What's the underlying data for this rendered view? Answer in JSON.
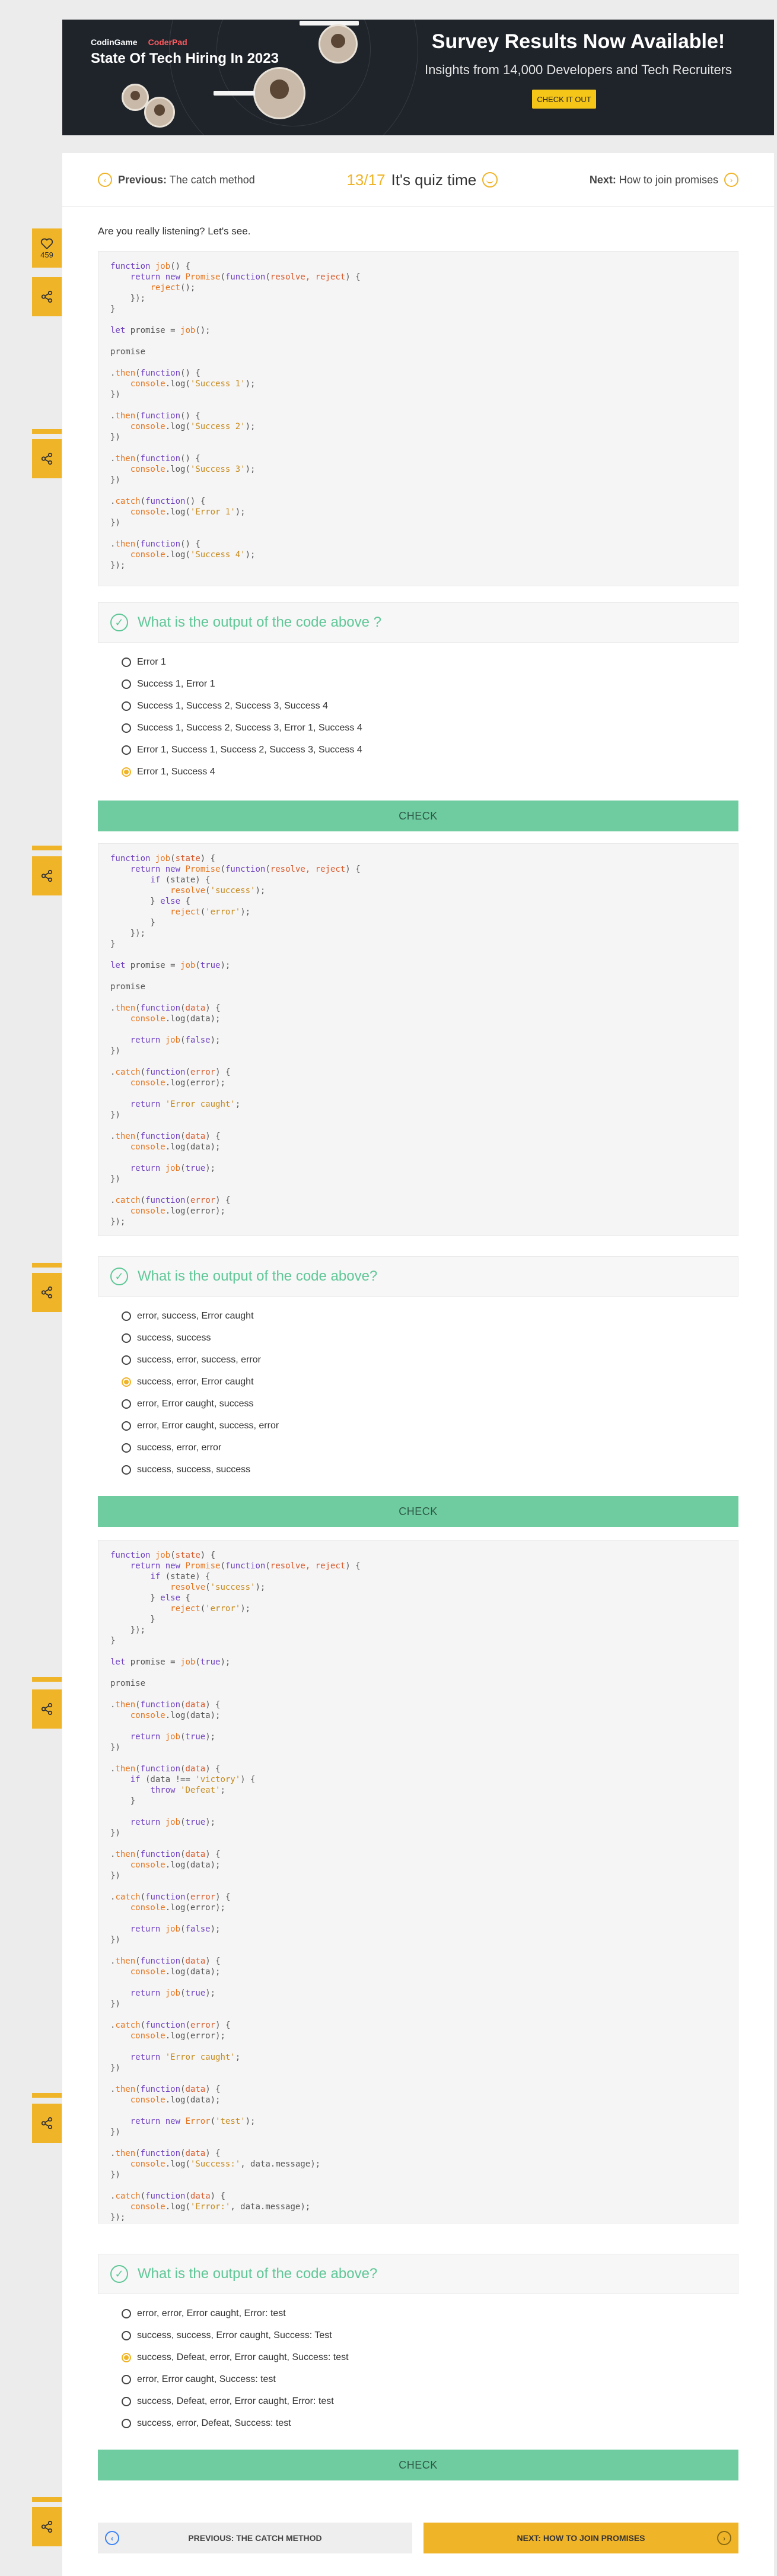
{
  "banner": {
    "logo_coderpad_prefix": "CodinGame",
    "logo_coderpad": "CoderPad",
    "title": "State Of Tech Hiring In 2023",
    "headline": "Survey Results Now Available!",
    "subtitle": "Insights from 14,000 Developers and Tech Recruiters",
    "cta": "CHECK IT OUT"
  },
  "nav": {
    "prev_label": "Previous:",
    "prev_title": "The catch method",
    "counter": "13/17",
    "center_text": "It's quiz time",
    "next_label": "Next:",
    "next_title": "How to join promises"
  },
  "intro": "Are you really listening? Let's see.",
  "likes": "459",
  "questions": [
    {
      "title": "What is the output of the code above ?",
      "options": [
        "Error 1",
        "Success 1, Error 1",
        "Success 1, Success 2, Success 3, Success 4",
        "Success 1, Success 2, Success 3, Error 1, Success 4",
        "Error 1, Success 1, Success 2, Success 3, Success 4",
        "Error 1, Success 4"
      ],
      "selected": 5,
      "check": "CHECK"
    },
    {
      "title": "What is the output of the code above?",
      "options": [
        "error, success, Error caught",
        "success, success",
        "success, error, success, error",
        "success, error, Error caught",
        "error, Error caught, success",
        "error, Error caught, success, error",
        "success, error, error",
        "success, success, success"
      ],
      "selected": 3,
      "check": "CHECK"
    },
    {
      "title": "What is the output of the code above?",
      "options": [
        "error, error, Error caught, Error: test",
        "success, success, Error caught, Success: Test",
        "success, Defeat, error, Error caught, Success: test",
        "error, Error caught, Success: test",
        "success, Defeat, error, Error caught, Error: test",
        "success, error, Defeat, Success: test"
      ],
      "selected": 2,
      "check": "CHECK"
    }
  ],
  "bottom": {
    "prev": "PREVIOUS: THE CATCH METHOD",
    "next": "NEXT: HOW TO JOIN PROMISES"
  },
  "icons": {
    "like": "heart-icon",
    "share": "share-icon",
    "check": "check-circle-icon",
    "prev": "arrow-left-circle-icon",
    "next": "arrow-right-circle-icon"
  },
  "colors": {
    "accent": "#f0b429",
    "success_green": "#5fc797",
    "check_button": "#6fcba0",
    "banner_bg": "#1f242b"
  }
}
